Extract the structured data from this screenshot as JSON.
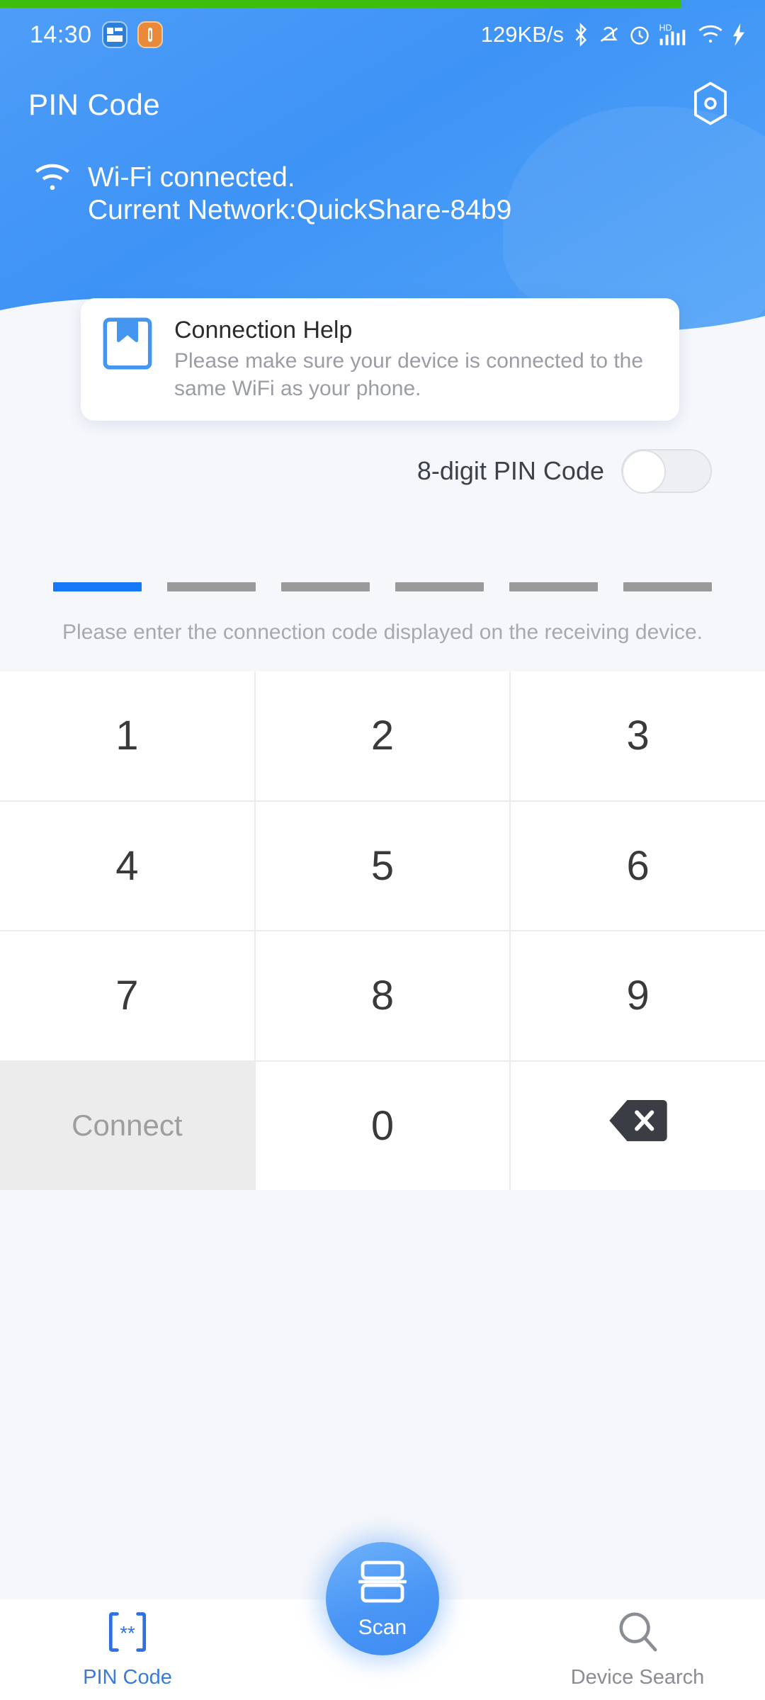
{
  "statusbar": {
    "time": "14:30",
    "network_speed": "129KB/s",
    "left_badges": [
      {
        "name": "app-badge-blue"
      },
      {
        "name": "app-badge-orange"
      }
    ],
    "icons": [
      "bluetooth-icon",
      "mute-bell-icon",
      "alarm-clock-icon",
      "hd-signal-icon",
      "wifi-icon",
      "charging-bolt-icon"
    ]
  },
  "progress": {
    "percent": 89,
    "color": "#3DBE0C"
  },
  "header": {
    "title": "PIN Code",
    "settings_icon": "hexagon-settings-icon",
    "wifi_status_line1": "Wi-Fi connected.",
    "wifi_status_line2": "Current Network:QuickShare-84b9",
    "background_color": "#3E93F6"
  },
  "help_card": {
    "icon": "bookmark-icon",
    "title": "Connection Help",
    "body": "Please make sure your device is connected to the same WiFi as your phone."
  },
  "toggle": {
    "label": "8-digit PIN Code",
    "state": "off"
  },
  "pin_entry": {
    "digit_count": 6,
    "active_index": 0,
    "entered": "",
    "hint": "Please enter the connection code displayed on the receiving device.",
    "active_color": "#1677F7",
    "inactive_color": "#9A9A9A"
  },
  "keypad": {
    "keys": [
      {
        "label": "1",
        "type": "digit"
      },
      {
        "label": "2",
        "type": "digit"
      },
      {
        "label": "3",
        "type": "digit"
      },
      {
        "label": "4",
        "type": "digit"
      },
      {
        "label": "5",
        "type": "digit"
      },
      {
        "label": "6",
        "type": "digit"
      },
      {
        "label": "7",
        "type": "digit"
      },
      {
        "label": "8",
        "type": "digit"
      },
      {
        "label": "9",
        "type": "digit"
      },
      {
        "label": "Connect",
        "type": "action"
      },
      {
        "label": "0",
        "type": "digit"
      },
      {
        "label": "",
        "type": "backspace"
      }
    ],
    "connect_label": "Connect",
    "backspace_icon": "backspace-icon"
  },
  "bottom_nav": {
    "items": [
      {
        "label": "PIN Code",
        "icon": "pin-code-icon",
        "active": true
      },
      {
        "label": "Device Search",
        "icon": "search-icon",
        "active": false
      }
    ],
    "scan": {
      "label": "Scan",
      "icon": "scan-frame-icon"
    },
    "active_color": "#3A7BD8",
    "inactive_color": "#8A8D93"
  }
}
